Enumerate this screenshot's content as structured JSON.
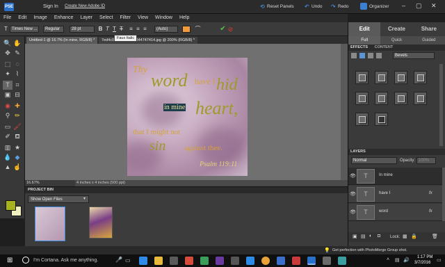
{
  "titlebar": {
    "sign_in": "Sign In",
    "create_id": "Create New Adobe ID",
    "reset_panels": "Reset Panels",
    "undo": "Undo",
    "redo": "Redo",
    "organizer": "Organizer"
  },
  "menu": [
    "File",
    "Edit",
    "Image",
    "Enhance",
    "Layer",
    "Select",
    "Filter",
    "View",
    "Window",
    "Help"
  ],
  "options": {
    "font_family": "Times New ...",
    "font_style": "Regular",
    "font_size": "28 pt",
    "leading": "(Auto)",
    "tooltip": "Faux Italic",
    "text_color": "#f39a3c"
  },
  "doc_tabs": [
    {
      "label": "Untitled-1 @ 16.7% (In mine, RGB/8) *"
    },
    {
      "label": "7ed4c0..."
    },
    {
      "label": "...ed18c344747414.jpg @ 200% (RGB/8) *"
    }
  ],
  "canvas_text": {
    "thy": "Thy",
    "word": "word",
    "have_i": "have I",
    "hid": "hid",
    "in_mine": "in mine",
    "heart": "heart,",
    "that_i_might_not": "that I might not",
    "sin": "sin",
    "against_thee": "against thee.",
    "reference": "Psalm 119:11"
  },
  "status": {
    "zoom": "16.67%",
    "doc_size": "4 inches x 4 inches (500 ppi)"
  },
  "project_bin": {
    "title": "PROJECT BIN",
    "dropdown": "Show Open Files"
  },
  "panel": {
    "mode_tabs": [
      "Edit",
      "Create",
      "Share"
    ],
    "active_mode": "Edit",
    "sub_tabs": [
      "Full",
      "Quick",
      "Guided"
    ],
    "effects_tabs": [
      "EFFECTS",
      "CONTENT"
    ],
    "effects_category": "Bevels",
    "layers_title": "LAYERS",
    "blend_mode": "Normal",
    "opacity_label": "Opacity:",
    "opacity_value": "100%",
    "lock_label": "Lock:",
    "layers": [
      {
        "name": "In mine",
        "selected": true
      },
      {
        "name": "have I",
        "selected": false
      },
      {
        "name": "word",
        "selected": false
      }
    ]
  },
  "notification": "Get perfection with PhotoMerge Group shot.",
  "taskbar": {
    "search_placeholder": "I'm Cortana. Ask me anything.",
    "time": "1:17 PM",
    "date": "3/7/2016"
  },
  "colors": {
    "foreground": "#a7b21e",
    "background": "#f0f0c0",
    "accent": "#2f8be8"
  }
}
